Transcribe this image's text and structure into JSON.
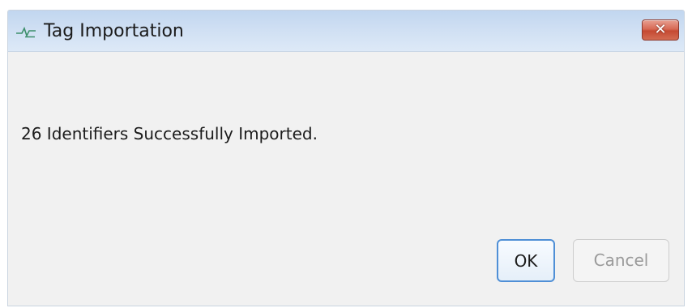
{
  "window": {
    "title": "Tag Importation",
    "close_label": "✕"
  },
  "message": "26 Identifiers Successfully Imported.",
  "buttons": {
    "ok_label": "OK",
    "cancel_label": "Cancel"
  },
  "colors": {
    "titlebar": "#cfdff3",
    "close_button": "#d76a55",
    "ok_border": "#4f8fd6",
    "dialog_background": "#f1f1f1"
  },
  "icons": {
    "title_icon": "tag-importation-icon"
  }
}
